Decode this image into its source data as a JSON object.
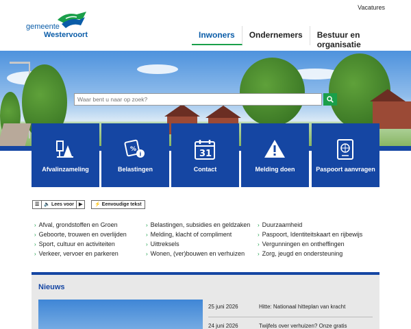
{
  "topbar": {
    "vacatures": "Vacatures"
  },
  "logo": {
    "line1": "gemeente",
    "line2": "Westervoort"
  },
  "nav": {
    "items": [
      "Inwoners",
      "Ondernemers",
      "Bestuur en organisatie"
    ],
    "active": 0
  },
  "search": {
    "placeholder": "Waar bent u naar op zoek?"
  },
  "tiles": [
    "Afvalinzameling",
    "Belastingen",
    "Contact",
    "Melding doen",
    "Paspoort aanvragen"
  ],
  "tile_icons": [
    "recycling-icon",
    "tax-icon",
    "calendar-icon",
    "warning-icon",
    "passport-icon"
  ],
  "calendar_number": "31",
  "readspeaker": {
    "lees_voor": "Lees voor",
    "eenvoudige": "Eenvoudige tekst"
  },
  "links": {
    "col1": [
      "Afval, grondstoffen en Groen",
      "Geboorte, trouwen en overlijden",
      "Sport, cultuur en activiteiten",
      "Verkeer, vervoer en parkeren"
    ],
    "col2": [
      "Belastingen, subsidies en geldzaken",
      "Melding, klacht of compliment",
      "Uittreksels",
      "Wonen, (ver)bouwen en verhuizen"
    ],
    "col3": [
      "Duurzaamheid",
      "Paspoort, Identiteitskaart en rijbewijs",
      "Vergunningen en ontheffingen",
      "Zorg, jeugd en ondersteuning"
    ]
  },
  "news": {
    "title": "Nieuws",
    "items": [
      {
        "date": "25 juni 2026",
        "title": "Hitte: Nationaal hitteplan van kracht"
      },
      {
        "date": "24 juni 2026",
        "title": "Twijfels over verhuizen? Onze gratis"
      }
    ]
  },
  "colors": {
    "brand_blue": "#1546a3",
    "accent_green": "#1a9f4a",
    "link_blue": "#0a5ca8"
  }
}
